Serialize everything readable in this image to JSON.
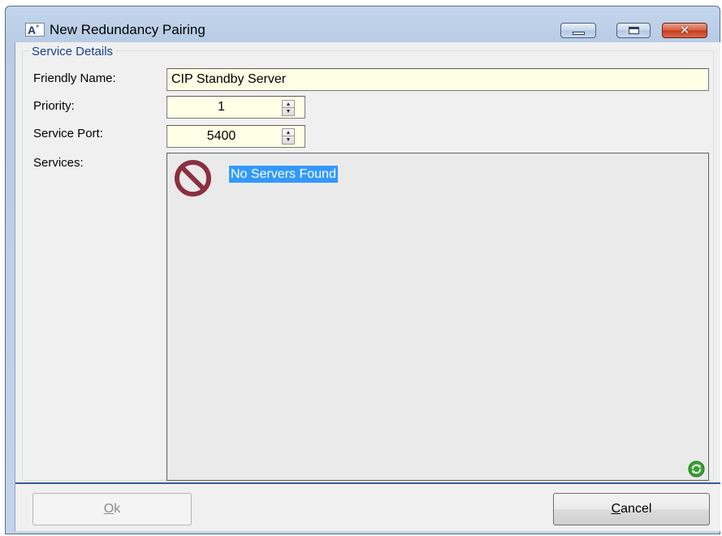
{
  "window": {
    "title": "New Redundancy Pairing",
    "icon_text": "A",
    "icon_sup": "»",
    "minimize_icon": "minimize-icon",
    "maximize_icon": "maximize-icon",
    "close_icon": "close-icon",
    "close_glyph": "✕"
  },
  "group": {
    "label": "Service Details"
  },
  "form": {
    "friendly_name_label": "Friendly Name:",
    "friendly_name_value": "CIP Standby Server",
    "priority_label": "Priority:",
    "priority_value": "1",
    "service_port_label": "Service Port:",
    "service_port_value": "5400",
    "services_label": "Services:"
  },
  "services": {
    "empty_message": "No Servers Found",
    "empty_icon": "no-entry-icon",
    "refresh_icon": "refresh-icon"
  },
  "buttons": {
    "ok_mnemonic": "O",
    "ok_rest": "k",
    "cancel_mnemonic": "C",
    "cancel_rest": "ancel"
  },
  "colors": {
    "selection": "#3399ff",
    "input_background": "#ffffe6",
    "close_button": "#c43d1d",
    "group_label": "#1a3f8e"
  }
}
